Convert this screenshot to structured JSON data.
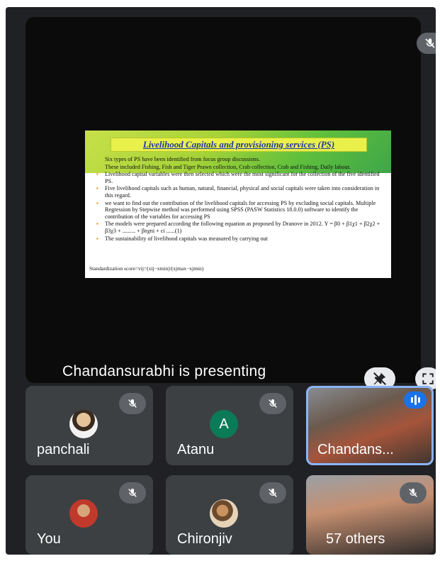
{
  "presentation": {
    "status": "Chandansurabhi is presenting",
    "slide": {
      "title": "Livelihood Capitals and provisioning services (PS)",
      "lines": [
        "Six types of PS have been identified from focus group discussions.",
        "These included Fishing, Fish and Tiger Prawn collection, Crab collection, Crab and Fishing, Daily labour.",
        "Livelihood capital variables were then selected which were the most significant for the collection of the five identified PS.",
        "Five livelihood capitals such as human, natural, financial, physical and social capitals were taken into consideration in this regard.",
        "we want to find out the contribution of the livelihood capitals for accessing PS by excluding social capitals. Multiple Regression by Stepwise method was performed using SPSS (PASW Statistics 18.0.0) software to identify the contribution of the variables for accessing PS",
        "The models were prepared according the following equation as proposed by Dranove in 2012. Y = β0 + β1χ1 + β2χ2 + β3χ3 + ......... + βnχni + εi ......(1)",
        "The sustainability of livelihood capitals was measured by carrying out"
      ],
      "formula": "Standardization score=vij=(xij−xmin)/(xjmax−xjmin)"
    }
  },
  "participants": [
    {
      "name": "panchali",
      "muted": true,
      "avatar": "photo"
    },
    {
      "name": "Atanu",
      "muted": true,
      "avatar": "A"
    },
    {
      "name": "Chandans...",
      "muted": false,
      "speaking": true,
      "avatar": "video"
    },
    {
      "name": "You",
      "muted": true,
      "avatar": "photo"
    },
    {
      "name": "Chironjiv",
      "muted": true,
      "avatar": "photo"
    },
    {
      "name": "57 others",
      "muted": true,
      "avatar": "video"
    }
  ],
  "icons": {
    "mic_off": "mic-off-icon",
    "pin_off": "pin-off-icon",
    "fullscreen": "fullscreen-icon",
    "speaking": "audio-level-icon"
  },
  "colors": {
    "background": "#202124",
    "tile": "#3c4043",
    "accent": "#1a73e8",
    "avatar_green": "#0b7a56"
  }
}
